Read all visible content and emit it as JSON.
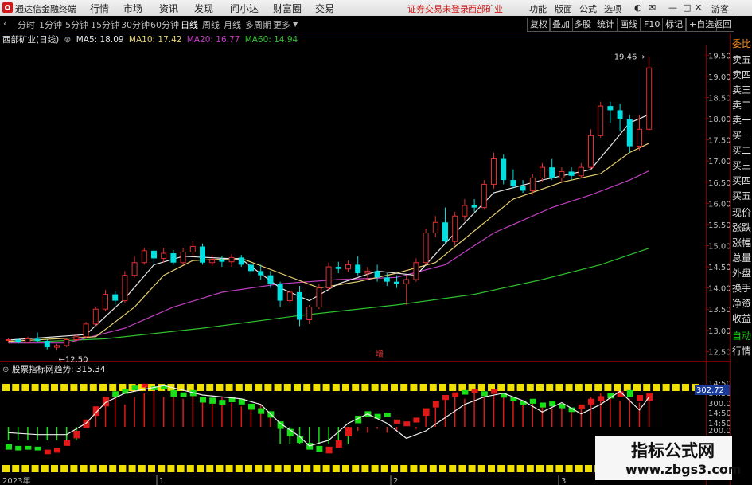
{
  "titlebar": {
    "app_title": "通达信金融终端",
    "menus": [
      "行情",
      "市场",
      "资讯",
      "发现",
      "问小达",
      "财富圈",
      "交易"
    ],
    "notice": "证券交易未登录",
    "notice_stock": "西部矿业",
    "right_menus": [
      "功能",
      "版面",
      "公式",
      "选项"
    ],
    "right_label": "游客"
  },
  "toolbar": {
    "periods": [
      "分时",
      "1分钟",
      "5分钟",
      "15分钟",
      "30分钟",
      "60分钟",
      "日线",
      "周线",
      "月线",
      "多周期",
      "更多"
    ],
    "active": "日线",
    "right_buttons": [
      "复权",
      "叠加",
      "多股",
      "统计",
      "画线",
      "F10",
      "标记",
      "+自选",
      "返回"
    ]
  },
  "info": {
    "stock_label": "西部矿业(日线)",
    "ma5": "MA5: 18.09",
    "ma10": "MA10: 17.42",
    "ma20": "MA20: 16.77",
    "ma60": "MA60: 14.94"
  },
  "indicator": {
    "name": "股票指标网",
    "trend_label": "趋势: 315.34",
    "readout": "302.72",
    "right_ticks": [
      "14:50",
      "14:50",
      "300.00",
      "14:50",
      "14:50",
      "200.00",
      "14:50",
      "14:50",
      "14:50"
    ]
  },
  "sidebar": [
    {
      "label": "委比",
      "tone": "orange"
    },
    {
      "label": "卖五",
      "tone": "white"
    },
    {
      "label": "卖四",
      "tone": "white"
    },
    {
      "label": "卖三",
      "tone": "white"
    },
    {
      "label": "卖二",
      "tone": "white"
    },
    {
      "label": "卖一",
      "tone": "white"
    },
    {
      "label": "买一",
      "tone": "white"
    },
    {
      "label": "买二",
      "tone": "white"
    },
    {
      "label": "买三",
      "tone": "white"
    },
    {
      "label": "买四",
      "tone": "white"
    },
    {
      "label": "买五",
      "tone": "white"
    },
    {
      "label": "现价",
      "tone": "white"
    },
    {
      "label": "涨跌",
      "tone": "white"
    },
    {
      "label": "涨幅",
      "tone": "white"
    },
    {
      "label": "总量",
      "tone": "white"
    },
    {
      "label": "外盘",
      "tone": "white"
    },
    {
      "label": "换手",
      "tone": "white"
    },
    {
      "label": "净资",
      "tone": "white"
    },
    {
      "label": "收益",
      "tone": "white"
    },
    {
      "label": "自动",
      "tone": "green"
    },
    {
      "label": "行情",
      "tone": "white"
    }
  ],
  "watermark": {
    "title": "指标公式网",
    "url": "www.zbgs3.com"
  },
  "colors": {
    "up": "#e03030",
    "down": "#00e0e0",
    "ma5": "#e6e6e6",
    "ma10": "#e8d070",
    "ma20": "#c040c0",
    "ma60": "#30c030",
    "yellow_block": "#f0e000",
    "ind_green": "#18e018",
    "ind_red": "#e01818",
    "grid_red": "#7a0000"
  },
  "chart_data": {
    "type": "candlestick",
    "ylim": [
      12.3,
      19.75
    ],
    "y_ticks": [
      "19.50",
      "19.00",
      "18.50",
      "18.00",
      "17.50",
      "17.00",
      "16.50",
      "16.00",
      "15.50",
      "15.00",
      "14.50",
      "14.00",
      "13.50",
      "13.00",
      "12.50"
    ],
    "annotations": {
      "high_label": "19.46",
      "low_label": "12.50"
    },
    "mid_marker": "增",
    "x_labels": [
      "2023年",
      "1",
      "2",
      "3"
    ],
    "candles": [
      [
        12.77,
        12.83,
        12.7,
        12.78
      ],
      [
        12.78,
        12.82,
        12.68,
        12.72
      ],
      [
        12.72,
        12.85,
        12.69,
        12.8
      ],
      [
        12.8,
        12.95,
        12.72,
        12.75
      ],
      [
        12.75,
        12.78,
        12.55,
        12.6
      ],
      [
        12.6,
        12.68,
        12.52,
        12.64
      ],
      [
        12.64,
        12.8,
        12.6,
        12.78
      ],
      [
        12.78,
        12.9,
        12.72,
        12.85
      ],
      [
        12.85,
        13.2,
        12.82,
        13.15
      ],
      [
        13.15,
        13.55,
        13.1,
        13.5
      ],
      [
        13.5,
        13.95,
        13.45,
        13.85
      ],
      [
        13.85,
        13.92,
        13.6,
        13.7
      ],
      [
        13.7,
        14.4,
        13.65,
        14.3
      ],
      [
        14.3,
        14.75,
        14.25,
        14.6
      ],
      [
        14.6,
        14.95,
        14.55,
        14.88
      ],
      [
        14.88,
        14.92,
        14.55,
        14.7
      ],
      [
        14.7,
        14.95,
        14.6,
        14.82
      ],
      [
        14.82,
        14.9,
        14.55,
        14.6
      ],
      [
        14.6,
        14.95,
        14.55,
        14.85
      ],
      [
        14.85,
        15.1,
        14.75,
        14.98
      ],
      [
        14.98,
        15.05,
        14.55,
        14.6
      ],
      [
        14.6,
        14.78,
        14.52,
        14.68
      ],
      [
        14.68,
        14.75,
        14.5,
        14.62
      ],
      [
        14.62,
        14.8,
        14.5,
        14.72
      ],
      [
        14.72,
        14.78,
        14.5,
        14.55
      ],
      [
        14.55,
        14.6,
        14.3,
        14.4
      ],
      [
        14.4,
        14.55,
        14.2,
        14.3
      ],
      [
        14.3,
        14.4,
        14.0,
        14.1
      ],
      [
        14.1,
        14.15,
        13.55,
        13.7
      ],
      [
        13.7,
        13.95,
        13.65,
        13.9
      ],
      [
        13.9,
        14.05,
        13.1,
        13.25
      ],
      [
        13.25,
        13.6,
        13.15,
        13.55
      ],
      [
        13.55,
        14.1,
        13.5,
        14.0
      ],
      [
        14.0,
        14.6,
        13.95,
        14.5
      ],
      [
        14.5,
        14.62,
        14.35,
        14.45
      ],
      [
        14.45,
        14.65,
        14.38,
        14.55
      ],
      [
        14.55,
        14.75,
        14.3,
        14.35
      ],
      [
        14.35,
        14.5,
        14.2,
        14.4
      ],
      [
        14.4,
        14.55,
        14.15,
        14.25
      ],
      [
        14.25,
        14.35,
        14.05,
        14.15
      ],
      [
        14.15,
        14.3,
        14.0,
        14.1
      ],
      [
        14.1,
        14.3,
        13.6,
        14.2
      ],
      [
        14.2,
        14.7,
        14.15,
        14.6
      ],
      [
        14.6,
        15.4,
        14.55,
        15.3
      ],
      [
        15.3,
        15.7,
        15.2,
        15.55
      ],
      [
        15.55,
        15.9,
        15.05,
        15.1
      ],
      [
        15.1,
        15.8,
        15.0,
        15.7
      ],
      [
        15.7,
        16.1,
        15.6,
        15.95
      ],
      [
        15.95,
        16.1,
        15.8,
        15.9
      ],
      [
        15.9,
        16.55,
        15.85,
        16.45
      ],
      [
        16.45,
        17.2,
        16.35,
        17.05
      ],
      [
        17.05,
        17.15,
        16.45,
        16.55
      ],
      [
        16.55,
        16.8,
        16.35,
        16.4
      ],
      [
        16.4,
        16.55,
        16.25,
        16.3
      ],
      [
        16.3,
        16.7,
        16.2,
        16.6
      ],
      [
        16.6,
        16.95,
        16.5,
        16.85
      ],
      [
        16.85,
        17.05,
        16.55,
        16.6
      ],
      [
        16.6,
        16.85,
        16.5,
        16.75
      ],
      [
        16.75,
        16.85,
        16.55,
        16.65
      ],
      [
        16.65,
        16.95,
        16.6,
        16.85
      ],
      [
        16.85,
        17.75,
        16.8,
        17.6
      ],
      [
        17.6,
        18.4,
        17.55,
        18.3
      ],
      [
        18.3,
        18.4,
        17.9,
        18.2
      ],
      [
        18.2,
        18.35,
        17.7,
        18.0
      ],
      [
        18.0,
        18.1,
        17.2,
        17.35
      ],
      [
        17.35,
        18.1,
        17.25,
        17.75
      ],
      [
        17.75,
        19.46,
        17.7,
        19.2
      ]
    ],
    "ma5": [
      [
        0,
        12.77
      ],
      [
        8,
        12.9
      ],
      [
        12,
        13.75
      ],
      [
        15,
        14.55
      ],
      [
        18,
        14.75
      ],
      [
        24,
        14.68
      ],
      [
        28,
        14.0
      ],
      [
        31,
        13.7
      ],
      [
        34,
        14.1
      ],
      [
        38,
        14.4
      ],
      [
        42,
        14.3
      ],
      [
        46,
        15.3
      ],
      [
        50,
        16.25
      ],
      [
        55,
        16.55
      ],
      [
        60,
        16.8
      ],
      [
        64,
        17.9
      ],
      [
        66,
        18.1
      ]
    ],
    "ma10": [
      [
        0,
        12.74
      ],
      [
        9,
        12.85
      ],
      [
        13,
        13.55
      ],
      [
        16,
        14.3
      ],
      [
        19,
        14.65
      ],
      [
        24,
        14.7
      ],
      [
        28,
        14.35
      ],
      [
        32,
        14.0
      ],
      [
        36,
        14.15
      ],
      [
        40,
        14.35
      ],
      [
        44,
        14.6
      ],
      [
        48,
        15.35
      ],
      [
        52,
        16.1
      ],
      [
        57,
        16.5
      ],
      [
        61,
        16.7
      ],
      [
        64,
        17.2
      ],
      [
        66,
        17.42
      ]
    ],
    "ma20": [
      [
        0,
        12.7
      ],
      [
        6,
        12.7
      ],
      [
        12,
        13.05
      ],
      [
        17,
        13.55
      ],
      [
        22,
        13.9
      ],
      [
        28,
        14.1
      ],
      [
        34,
        14.2
      ],
      [
        40,
        14.25
      ],
      [
        45,
        14.55
      ],
      [
        50,
        15.3
      ],
      [
        56,
        15.9
      ],
      [
        60,
        16.2
      ],
      [
        64,
        16.55
      ],
      [
        66,
        16.77
      ]
    ],
    "ma60": [
      [
        0,
        12.7
      ],
      [
        10,
        12.8
      ],
      [
        20,
        13.05
      ],
      [
        30,
        13.35
      ],
      [
        40,
        13.6
      ],
      [
        48,
        13.85
      ],
      [
        55,
        14.2
      ],
      [
        61,
        14.55
      ],
      [
        66,
        14.94
      ]
    ],
    "indicator": {
      "ylim": [
        100,
        360
      ],
      "line": [
        [
          0,
          205
        ],
        [
          3,
          200
        ],
        [
          6,
          200
        ],
        [
          8,
          230
        ],
        [
          10,
          285
        ],
        [
          12,
          310
        ],
        [
          14,
          320
        ],
        [
          16,
          330
        ],
        [
          18,
          318
        ],
        [
          20,
          305
        ],
        [
          22,
          300
        ],
        [
          24,
          295
        ],
        [
          26,
          280
        ],
        [
          28,
          230
        ],
        [
          30,
          195
        ],
        [
          31,
          170
        ],
        [
          33,
          185
        ],
        [
          35,
          230
        ],
        [
          37,
          255
        ],
        [
          39,
          230
        ],
        [
          41,
          190
        ],
        [
          43,
          210
        ],
        [
          45,
          245
        ],
        [
          47,
          280
        ],
        [
          49,
          300
        ],
        [
          51,
          310
        ],
        [
          53,
          290
        ],
        [
          55,
          260
        ],
        [
          57,
          285
        ],
        [
          59,
          255
        ],
        [
          61,
          280
        ],
        [
          63,
          315
        ],
        [
          65,
          265
        ],
        [
          66,
          300
        ]
      ],
      "stems": [
        0,
        0,
        0,
        0,
        0,
        0,
        0,
        0,
        0,
        255,
        290,
        300,
        280,
        300,
        310,
        320,
        300,
        305,
        295,
        310,
        300,
        290,
        300,
        285,
        275,
        270,
        280,
        255,
        0,
        0,
        0,
        0,
        0,
        0,
        0,
        0,
        210,
        205,
        215,
        205,
        210,
        0,
        215,
        260,
        285,
        300,
        305,
        295,
        310,
        300,
        305,
        310,
        290,
        280,
        285,
        275,
        270,
        280,
        265,
        270,
        300,
        310,
        300,
        290,
        295,
        285,
        300
      ],
      "boxes": [
        [
          0,
          175,
          160,
          "g"
        ],
        [
          1,
          170,
          158,
          "g"
        ],
        [
          2,
          170,
          160,
          "g"
        ],
        [
          3,
          168,
          158,
          "g"
        ],
        [
          4,
          160,
          148,
          "r"
        ],
        [
          5,
          165,
          152,
          "r"
        ],
        [
          6,
          185,
          170,
          "r"
        ],
        [
          7,
          210,
          190,
          "r"
        ],
        [
          8,
          240,
          218,
          "r"
        ],
        [
          9,
          275,
          250,
          "r"
        ],
        [
          10,
          300,
          275,
          "r"
        ],
        [
          11,
          315,
          300,
          "g"
        ],
        [
          12,
          322,
          308,
          "g"
        ],
        [
          13,
          330,
          318,
          "g"
        ],
        [
          14,
          335,
          325,
          "r"
        ],
        [
          15,
          328,
          318,
          "g"
        ],
        [
          16,
          332,
          320,
          "g"
        ],
        [
          17,
          318,
          300,
          "g"
        ],
        [
          18,
          312,
          300,
          "g"
        ],
        [
          19,
          318,
          302,
          "g"
        ],
        [
          20,
          300,
          285,
          "g"
        ],
        [
          21,
          298,
          282,
          "g"
        ],
        [
          22,
          292,
          278,
          "g"
        ],
        [
          23,
          300,
          286,
          "g"
        ],
        [
          24,
          295,
          280,
          "g"
        ],
        [
          25,
          282,
          266,
          "g"
        ],
        [
          26,
          270,
          255,
          "g"
        ],
        [
          27,
          262,
          245,
          "g"
        ],
        [
          28,
          235,
          215,
          "g"
        ],
        [
          29,
          215,
          195,
          "g"
        ],
        [
          30,
          195,
          178,
          "g"
        ],
        [
          31,
          178,
          160,
          "g"
        ],
        [
          32,
          170,
          155,
          "g"
        ],
        [
          33,
          168,
          150,
          "r"
        ],
        [
          34,
          185,
          165,
          "r"
        ],
        [
          35,
          220,
          195,
          "r"
        ],
        [
          36,
          250,
          230,
          "g"
        ],
        [
          37,
          262,
          248,
          "g"
        ],
        [
          38,
          255,
          242,
          "g"
        ],
        [
          39,
          258,
          246,
          "g"
        ],
        [
          40,
          240,
          228,
          "r"
        ],
        [
          41,
          235,
          222,
          "r"
        ],
        [
          42,
          245,
          232,
          "r"
        ],
        [
          43,
          270,
          250,
          "r"
        ],
        [
          44,
          290,
          272,
          "r"
        ],
        [
          45,
          305,
          292,
          "r"
        ],
        [
          46,
          312,
          300,
          "r"
        ],
        [
          47,
          318,
          306,
          "g"
        ],
        [
          48,
          322,
          310,
          "r"
        ],
        [
          49,
          315,
          302,
          "g"
        ],
        [
          50,
          320,
          308,
          "r"
        ],
        [
          51,
          310,
          298,
          "g"
        ],
        [
          52,
          300,
          288,
          "g"
        ],
        [
          53,
          290,
          278,
          "g"
        ],
        [
          54,
          295,
          282,
          "g"
        ],
        [
          55,
          285,
          272,
          "g"
        ],
        [
          56,
          288,
          275,
          "g"
        ],
        [
          57,
          282,
          270,
          "g"
        ],
        [
          58,
          272,
          260,
          "g"
        ],
        [
          59,
          280,
          268,
          "r"
        ],
        [
          60,
          295,
          280,
          "r"
        ],
        [
          61,
          302,
          288,
          "r"
        ],
        [
          62,
          310,
          296,
          "g"
        ],
        [
          63,
          315,
          300,
          "r"
        ],
        [
          64,
          318,
          300,
          "g"
        ],
        [
          65,
          305,
          290,
          "r"
        ],
        [
          66,
          310,
          290,
          "r"
        ]
      ]
    }
  }
}
